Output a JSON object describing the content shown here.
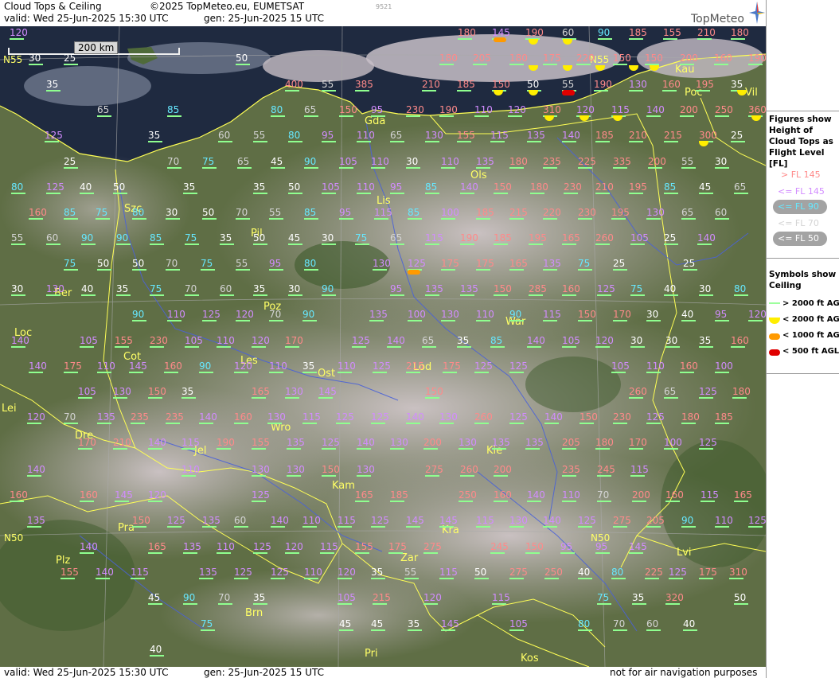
{
  "header": {
    "title": "Cloud Tops & Ceiling",
    "copyright": "©2025 TopMeteo.eu, EUMETSAT",
    "code": "9521",
    "valid": "valid:  Wed  25-Jun-2025  15:30 UTC",
    "gen": "gen: 25-Jun-2025 15 UTC",
    "logo": "TopMeteo"
  },
  "footer": {
    "valid": "valid:  Wed  25-Jun-2025  15:30 UTC",
    "gen": "gen: 25-Jun-2025 15 UTC",
    "disclaimer": "not for air navigation purposes"
  },
  "scale": "200 km",
  "legend": {
    "title": "Figures show Height of Cloud Tops as Flight Level  [FL]",
    "items": [
      "> FL 145",
      "<= FL 145",
      "<= FL 90",
      "<= FL 70",
      "<= FL 50"
    ],
    "symbols_title": "Symbols show Ceiling",
    "symbols": [
      "> 2000 ft AGL",
      "< 2000 ft AGL",
      "< 1000 ft AGL",
      "< 500 ft AGL"
    ],
    "colors": {
      "gt145": "#ff8a8a",
      "le145": "#d28cff",
      "le90": "#66e8ff",
      "le70": "#d4d4d4",
      "le50": "#ffffff",
      "gt2000": "#9dff9d",
      "lt2000": "#ffee00",
      "lt1000": "#ff9a00",
      "lt500": "#e00000"
    }
  },
  "grid_labels": [
    "N55",
    "N55",
    "N50",
    "N50"
  ],
  "cities": [
    "Gda",
    "Kau",
    "Poc",
    "Vil",
    "Szc",
    "Ols",
    "Lis",
    "Pil",
    "Ber",
    "Poz",
    "War",
    "Loc",
    "Cot",
    "Les",
    "Ost",
    "Lod",
    "Lei",
    "Dre",
    "Wro",
    "Jel",
    "Kie",
    "Kam",
    "Pra",
    "Kra",
    "Plz",
    "Zar",
    "Lvi",
    "Brn",
    "Pri",
    "Kos"
  ],
  "figures": [
    "120",
    "180",
    "145",
    "190",
    "60",
    "90",
    "185",
    "155",
    "210",
    "180",
    "N55x",
    "30",
    "25",
    "50",
    "180",
    "205",
    "180",
    "175",
    "220",
    "150",
    "150",
    "200",
    "160",
    "190",
    "35",
    "400",
    "55",
    "385",
    "210",
    "185",
    "150",
    "50",
    "55",
    "190",
    "130",
    "160",
    "195",
    "35",
    "65",
    "85",
    "80",
    "65",
    "150",
    "95",
    "230",
    "190",
    "110",
    "120",
    "310",
    "120",
    "115",
    "140",
    "200",
    "250",
    "360",
    "125",
    "35",
    "60",
    "55",
    "80",
    "95",
    "110",
    "65",
    "130",
    "155",
    "115",
    "135",
    "140",
    "185",
    "210",
    "215",
    "300",
    "25",
    "25",
    "70",
    "75",
    "65",
    "45",
    "90",
    "105",
    "110",
    "30",
    "110",
    "135",
    "180",
    "235",
    "225",
    "335",
    "200",
    "55",
    "30",
    "80",
    "125",
    "40",
    "50",
    "35",
    "35",
    "50",
    "105",
    "110",
    "95",
    "85",
    "140",
    "150",
    "180",
    "230",
    "210",
    "195",
    "85",
    "45",
    "65",
    "160",
    "85",
    "75",
    "80",
    "30",
    "50",
    "70",
    "55",
    "85",
    "95",
    "115",
    "85",
    "100",
    "185",
    "215",
    "220",
    "230",
    "195",
    "130",
    "65",
    "60",
    "55",
    "60",
    "90",
    "90",
    "85",
    "75",
    "35",
    "50",
    "45",
    "30",
    "75",
    "65",
    "115",
    "190",
    "185",
    "195",
    "165",
    "260",
    "105",
    "25",
    "140",
    "75",
    "50",
    "50",
    "70",
    "75",
    "55",
    "95",
    "80",
    "130",
    "125",
    "175",
    "175",
    "165",
    "135",
    "75",
    "25",
    "25",
    "30",
    "130",
    "40",
    "35",
    "75",
    "70",
    "60",
    "35",
    "30",
    "90",
    "95",
    "135",
    "135",
    "150",
    "285",
    "160",
    "125",
    "75",
    "40",
    "30",
    "80",
    "90",
    "110",
    "125",
    "120",
    "70",
    "90",
    "135",
    "100",
    "130",
    "110",
    "90",
    "115",
    "150",
    "170",
    "30",
    "40",
    "95",
    "120",
    "140",
    "105",
    "155",
    "230",
    "105",
    "110",
    "120",
    "170",
    "125",
    "140",
    "65",
    "35",
    "85",
    "140",
    "105",
    "120",
    "30",
    "30",
    "35",
    "160",
    "140",
    "175",
    "110",
    "145",
    "160",
    "90",
    "120",
    "110",
    "35",
    "110",
    "125",
    "215",
    "175",
    "125",
    "125",
    "105",
    "110",
    "160",
    "100",
    "105",
    "130",
    "150",
    "35",
    "165",
    "130",
    "145",
    "150",
    "260",
    "65",
    "125",
    "180",
    "120",
    "70",
    "135",
    "235",
    "235",
    "140",
    "160",
    "130",
    "115",
    "125",
    "125",
    "140",
    "130",
    "260",
    "125",
    "140",
    "150",
    "230",
    "125",
    "180",
    "185",
    "170",
    "210",
    "140",
    "115",
    "190",
    "155",
    "135",
    "125",
    "140",
    "130",
    "200",
    "130",
    "135",
    "135",
    "205",
    "180",
    "170",
    "100",
    "125",
    "140",
    "110",
    "130",
    "130",
    "150",
    "130",
    "275",
    "260",
    "200",
    "235",
    "245",
    "115",
    "160",
    "160",
    "145",
    "120",
    "125",
    "165",
    "185",
    "250",
    "160",
    "140",
    "110",
    "70",
    "200",
    "160",
    "115",
    "165",
    "135",
    "150",
    "125",
    "135",
    "60",
    "140",
    "110",
    "115",
    "125",
    "145",
    "145",
    "115",
    "130",
    "140",
    "125",
    "275",
    "205",
    "90",
    "110",
    "125",
    "140",
    "165",
    "135",
    "110",
    "125",
    "120",
    "115",
    "155",
    "175",
    "275",
    "245",
    "150",
    "95",
    "95",
    "145",
    "155",
    "140",
    "115",
    "135",
    "125",
    "125",
    "110",
    "120",
    "35",
    "55",
    "115",
    "50",
    "275",
    "250",
    "40",
    "80",
    "225",
    "125",
    "175",
    "310",
    "45",
    "90",
    "70",
    "35",
    "105",
    "215",
    "120",
    "115",
    "75",
    "35",
    "320",
    "50",
    "75",
    "45",
    "45",
    "35",
    "145",
    "105",
    "80",
    "70",
    "60",
    "40",
    "40"
  ]
}
